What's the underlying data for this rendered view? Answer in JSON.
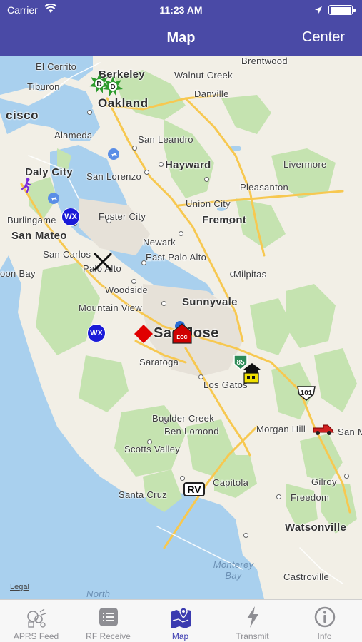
{
  "status_bar": {
    "carrier": "Carrier",
    "time": "11:23 AM"
  },
  "nav": {
    "title": "Map",
    "center_button": "Center"
  },
  "map": {
    "places": {
      "el_cerrito": "El Cerrito",
      "berkeley": "Berkeley",
      "walnut_creek": "Walnut Creek",
      "brentwood": "Brentwood",
      "tiburon": "Tiburon",
      "oakland": "Oakland",
      "danville": "Danville",
      "sf": "cisco",
      "alameda": "Alameda",
      "san_leandro": "San Leandro",
      "daly_city": "Daly City",
      "san_lorenzo": "San Lorenzo",
      "hayward": "Hayward",
      "livermore": "Livermore",
      "pleasanton": "Pleasanton",
      "union_city": "Union City",
      "burlingame": "Burlingame",
      "foster_city": "Foster City",
      "fremont": "Fremont",
      "san_mateo": "San Mateo",
      "newark": "Newark",
      "san_carlos": "San Carlos",
      "east_palo_alto": "East Palo Alto",
      "palo_alto": "Palo Alto",
      "half_moon_bay": "oon Bay",
      "milpitas": "Milpitas",
      "woodside": "Woodside",
      "mountain_view": "Mountain View",
      "sunnyvale": "Sunnyvale",
      "san_jose": "San Jose",
      "saratoga": "Saratoga",
      "los_gatos": "Los Gatos",
      "boulder_creek": "Boulder Creek",
      "ben_lomond": "Ben Lomond",
      "morgan_hill": "Morgan Hill",
      "san_martin": "San M",
      "scotts_valley": "Scotts Valley",
      "santa_cruz": "Santa Cruz",
      "capitola": "Capitola",
      "gilroy": "Gilroy",
      "freedom": "Freedom",
      "watsonville": "Watsonville",
      "monterey_bay": "Monterey\nBay",
      "castroville": "Castroville",
      "north": "North"
    },
    "shields": {
      "hwy85": "85",
      "us101": "101",
      "rv": "RV"
    },
    "markers": {
      "wx1": "WX",
      "wx2": "WX",
      "d1": "D",
      "d2": "D",
      "eoc": "EOC"
    },
    "legal": "Legal"
  },
  "tabs": [
    {
      "label": "APRS Feed",
      "icon": "aprs-feed-icon",
      "active": false
    },
    {
      "label": "RF Receive",
      "icon": "list-icon",
      "active": false
    },
    {
      "label": "Map",
      "icon": "map-icon",
      "active": true
    },
    {
      "label": "Transmit",
      "icon": "lightning-icon",
      "active": false
    },
    {
      "label": "Info",
      "icon": "info-icon",
      "active": false
    }
  ],
  "colors": {
    "nav_bg": "#4a4aa6",
    "active_tab": "#3b3bb0",
    "water": "#a9d0ee",
    "park": "#c5e3b0"
  }
}
